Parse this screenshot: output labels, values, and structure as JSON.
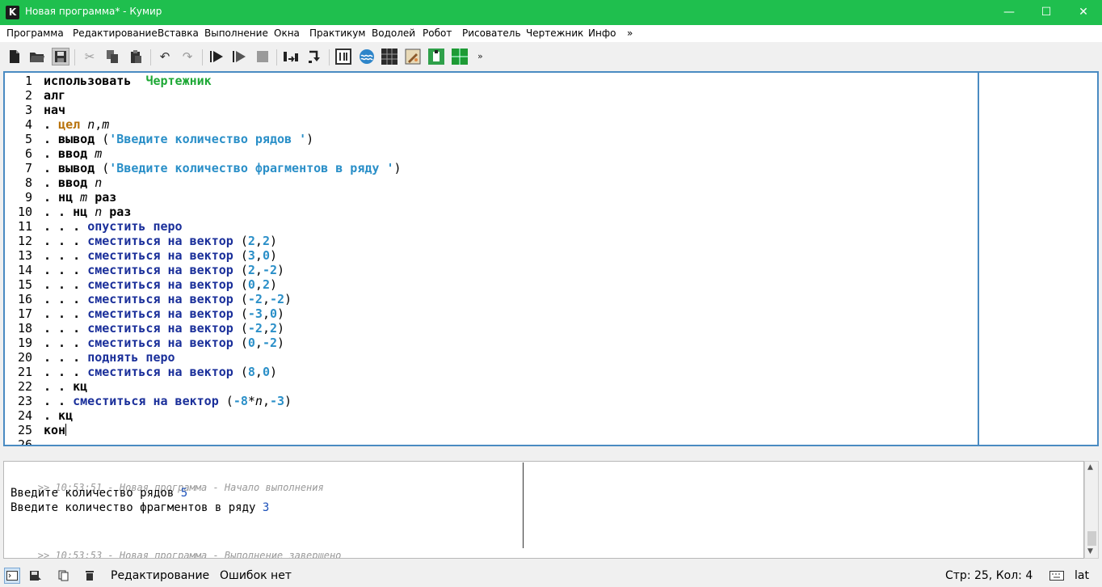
{
  "window": {
    "title": "Новая программа* - Кумир",
    "app_icon_letter": "K",
    "min_glyph": "—",
    "max_glyph": "☐",
    "close_glyph": "✕",
    "accent": "#1fbf4e"
  },
  "menu": {
    "items": [
      "Программа",
      "Редактирование",
      "Вставка",
      "Выполнение",
      "Окна",
      "Практикум",
      "Водолей",
      "Робот",
      "Рисователь",
      "Чертежник",
      "Инфо",
      "»"
    ]
  },
  "toolbar": {
    "icons": [
      "new-file-icon",
      "open-folder-icon",
      "save-icon",
      "cut-icon",
      "copy-icon",
      "paste-icon",
      "undo-icon",
      "redo-icon",
      "run-icon",
      "run-step-icon",
      "stop-icon",
      "step-over-icon",
      "step-into-icon",
      "counter-icon",
      "vodoley-icon",
      "robot-grid-icon",
      "draw-icon",
      "paint-icon",
      "chertezhnik-icon"
    ],
    "overflow": "»"
  },
  "editor": {
    "lines": [
      {
        "n": "1",
        "parts": [
          {
            "t": "использовать",
            "c": "k"
          },
          {
            "t": "  ",
            "c": "p"
          },
          {
            "t": "Чертежник",
            "c": "g"
          }
        ]
      },
      {
        "n": "2",
        "parts": [
          {
            "t": "алг",
            "c": "k"
          }
        ]
      },
      {
        "n": "3",
        "parts": [
          {
            "t": "нач",
            "c": "k"
          }
        ]
      },
      {
        "n": "4",
        "parts": [
          {
            "t": ". ",
            "c": "k"
          },
          {
            "t": "цел",
            "c": "o"
          },
          {
            "t": " ",
            "c": "p"
          },
          {
            "t": "n",
            "c": "v"
          },
          {
            "t": ",",
            "c": "p"
          },
          {
            "t": "m",
            "c": "v"
          }
        ]
      },
      {
        "n": "5",
        "parts": [
          {
            "t": ". вывод",
            "c": "k"
          },
          {
            "t": " (",
            "c": "p"
          },
          {
            "t": "'Введите количество рядов '",
            "c": "s"
          },
          {
            "t": ")",
            "c": "p"
          }
        ]
      },
      {
        "n": "6",
        "parts": [
          {
            "t": ". ввод",
            "c": "k"
          },
          {
            "t": " ",
            "c": "p"
          },
          {
            "t": "m",
            "c": "v"
          }
        ]
      },
      {
        "n": "7",
        "parts": [
          {
            "t": ". вывод",
            "c": "k"
          },
          {
            "t": " (",
            "c": "p"
          },
          {
            "t": "'Введите количество фрагментов в ряду '",
            "c": "s"
          },
          {
            "t": ")",
            "c": "p"
          }
        ]
      },
      {
        "n": "8",
        "parts": [
          {
            "t": ". ввод",
            "c": "k"
          },
          {
            "t": " ",
            "c": "p"
          },
          {
            "t": "n",
            "c": "v"
          }
        ]
      },
      {
        "n": "9",
        "parts": [
          {
            "t": ". нц",
            "c": "k"
          },
          {
            "t": " ",
            "c": "p"
          },
          {
            "t": "m",
            "c": "v"
          },
          {
            "t": " раз",
            "c": "k"
          }
        ]
      },
      {
        "n": "10",
        "parts": [
          {
            "t": ". . нц",
            "c": "k"
          },
          {
            "t": " ",
            "c": "p"
          },
          {
            "t": "n",
            "c": "v"
          },
          {
            "t": " раз",
            "c": "k"
          }
        ]
      },
      {
        "n": "11",
        "parts": [
          {
            "t": ". . . ",
            "c": "k"
          },
          {
            "t": "опустить перо",
            "c": "a"
          }
        ]
      },
      {
        "n": "12",
        "parts": [
          {
            "t": ". . . ",
            "c": "k"
          },
          {
            "t": "сместиться на вектор",
            "c": "a"
          },
          {
            "t": " (",
            "c": "p"
          },
          {
            "t": "2",
            "c": "n"
          },
          {
            "t": ",",
            "c": "p"
          },
          {
            "t": "2",
            "c": "n"
          },
          {
            "t": ")",
            "c": "p"
          }
        ]
      },
      {
        "n": "13",
        "parts": [
          {
            "t": ". . . ",
            "c": "k"
          },
          {
            "t": "сместиться на вектор",
            "c": "a"
          },
          {
            "t": " (",
            "c": "p"
          },
          {
            "t": "3",
            "c": "n"
          },
          {
            "t": ",",
            "c": "p"
          },
          {
            "t": "0",
            "c": "n"
          },
          {
            "t": ")",
            "c": "p"
          }
        ]
      },
      {
        "n": "14",
        "parts": [
          {
            "t": ". . . ",
            "c": "k"
          },
          {
            "t": "сместиться на вектор",
            "c": "a"
          },
          {
            "t": " (",
            "c": "p"
          },
          {
            "t": "2",
            "c": "n"
          },
          {
            "t": ",",
            "c": "p"
          },
          {
            "t": "-2",
            "c": "n"
          },
          {
            "t": ")",
            "c": "p"
          }
        ]
      },
      {
        "n": "15",
        "parts": [
          {
            "t": ". . . ",
            "c": "k"
          },
          {
            "t": "сместиться на вектор",
            "c": "a"
          },
          {
            "t": " (",
            "c": "p"
          },
          {
            "t": "0",
            "c": "n"
          },
          {
            "t": ",",
            "c": "p"
          },
          {
            "t": "2",
            "c": "n"
          },
          {
            "t": ")",
            "c": "p"
          }
        ]
      },
      {
        "n": "16",
        "parts": [
          {
            "t": ". . . ",
            "c": "k"
          },
          {
            "t": "сместиться на вектор",
            "c": "a"
          },
          {
            "t": " (",
            "c": "p"
          },
          {
            "t": "-2",
            "c": "n"
          },
          {
            "t": ",",
            "c": "p"
          },
          {
            "t": "-2",
            "c": "n"
          },
          {
            "t": ")",
            "c": "p"
          }
        ]
      },
      {
        "n": "17",
        "parts": [
          {
            "t": ". . . ",
            "c": "k"
          },
          {
            "t": "сместиться на вектор",
            "c": "a"
          },
          {
            "t": " (",
            "c": "p"
          },
          {
            "t": "-3",
            "c": "n"
          },
          {
            "t": ",",
            "c": "p"
          },
          {
            "t": "0",
            "c": "n"
          },
          {
            "t": ")",
            "c": "p"
          }
        ]
      },
      {
        "n": "18",
        "parts": [
          {
            "t": ". . . ",
            "c": "k"
          },
          {
            "t": "сместиться на вектор",
            "c": "a"
          },
          {
            "t": " (",
            "c": "p"
          },
          {
            "t": "-2",
            "c": "n"
          },
          {
            "t": ",",
            "c": "p"
          },
          {
            "t": "2",
            "c": "n"
          },
          {
            "t": ")",
            "c": "p"
          }
        ]
      },
      {
        "n": "19",
        "parts": [
          {
            "t": ". . . ",
            "c": "k"
          },
          {
            "t": "сместиться на вектор",
            "c": "a"
          },
          {
            "t": " (",
            "c": "p"
          },
          {
            "t": "0",
            "c": "n"
          },
          {
            "t": ",",
            "c": "p"
          },
          {
            "t": "-2",
            "c": "n"
          },
          {
            "t": ")",
            "c": "p"
          }
        ]
      },
      {
        "n": "20",
        "parts": [
          {
            "t": ". . . ",
            "c": "k"
          },
          {
            "t": "поднять перо",
            "c": "a"
          }
        ]
      },
      {
        "n": "21",
        "parts": [
          {
            "t": ". . . ",
            "c": "k"
          },
          {
            "t": "сместиться на вектор",
            "c": "a"
          },
          {
            "t": " (",
            "c": "p"
          },
          {
            "t": "8",
            "c": "n"
          },
          {
            "t": ",",
            "c": "p"
          },
          {
            "t": "0",
            "c": "n"
          },
          {
            "t": ")",
            "c": "p"
          }
        ]
      },
      {
        "n": "22",
        "parts": [
          {
            "t": ". . кц",
            "c": "k"
          }
        ]
      },
      {
        "n": "23",
        "parts": [
          {
            "t": ". . ",
            "c": "k"
          },
          {
            "t": "сместиться на вектор",
            "c": "a"
          },
          {
            "t": " (",
            "c": "p"
          },
          {
            "t": "-8",
            "c": "n"
          },
          {
            "t": "*",
            "c": "p"
          },
          {
            "t": "n",
            "c": "v"
          },
          {
            "t": ",",
            "c": "p"
          },
          {
            "t": "-3",
            "c": "n"
          },
          {
            "t": ")",
            "c": "p"
          }
        ]
      },
      {
        "n": "24",
        "parts": [
          {
            "t": ". кц",
            "c": "k"
          }
        ]
      },
      {
        "n": "25",
        "parts": [
          {
            "t": "кон",
            "c": "k"
          }
        ],
        "cursor": true
      },
      {
        "n": "26",
        "parts": []
      }
    ]
  },
  "console": {
    "start_meta": ">> 10:53:51 - Новая программа - Начало выполнения",
    "output": [
      {
        "text": "Введите количество рядов ",
        "value": "5"
      },
      {
        "text": "Введите количество фрагментов в ряду ",
        "value": "3"
      }
    ],
    "end_meta": ">> 10:53:53 - Новая программа - Выполнение завершено"
  },
  "statusbar": {
    "mode": "Редактирование",
    "errors": "Ошибок нет",
    "position": "Стр: 25, Кол: 4",
    "layout": "lat"
  }
}
